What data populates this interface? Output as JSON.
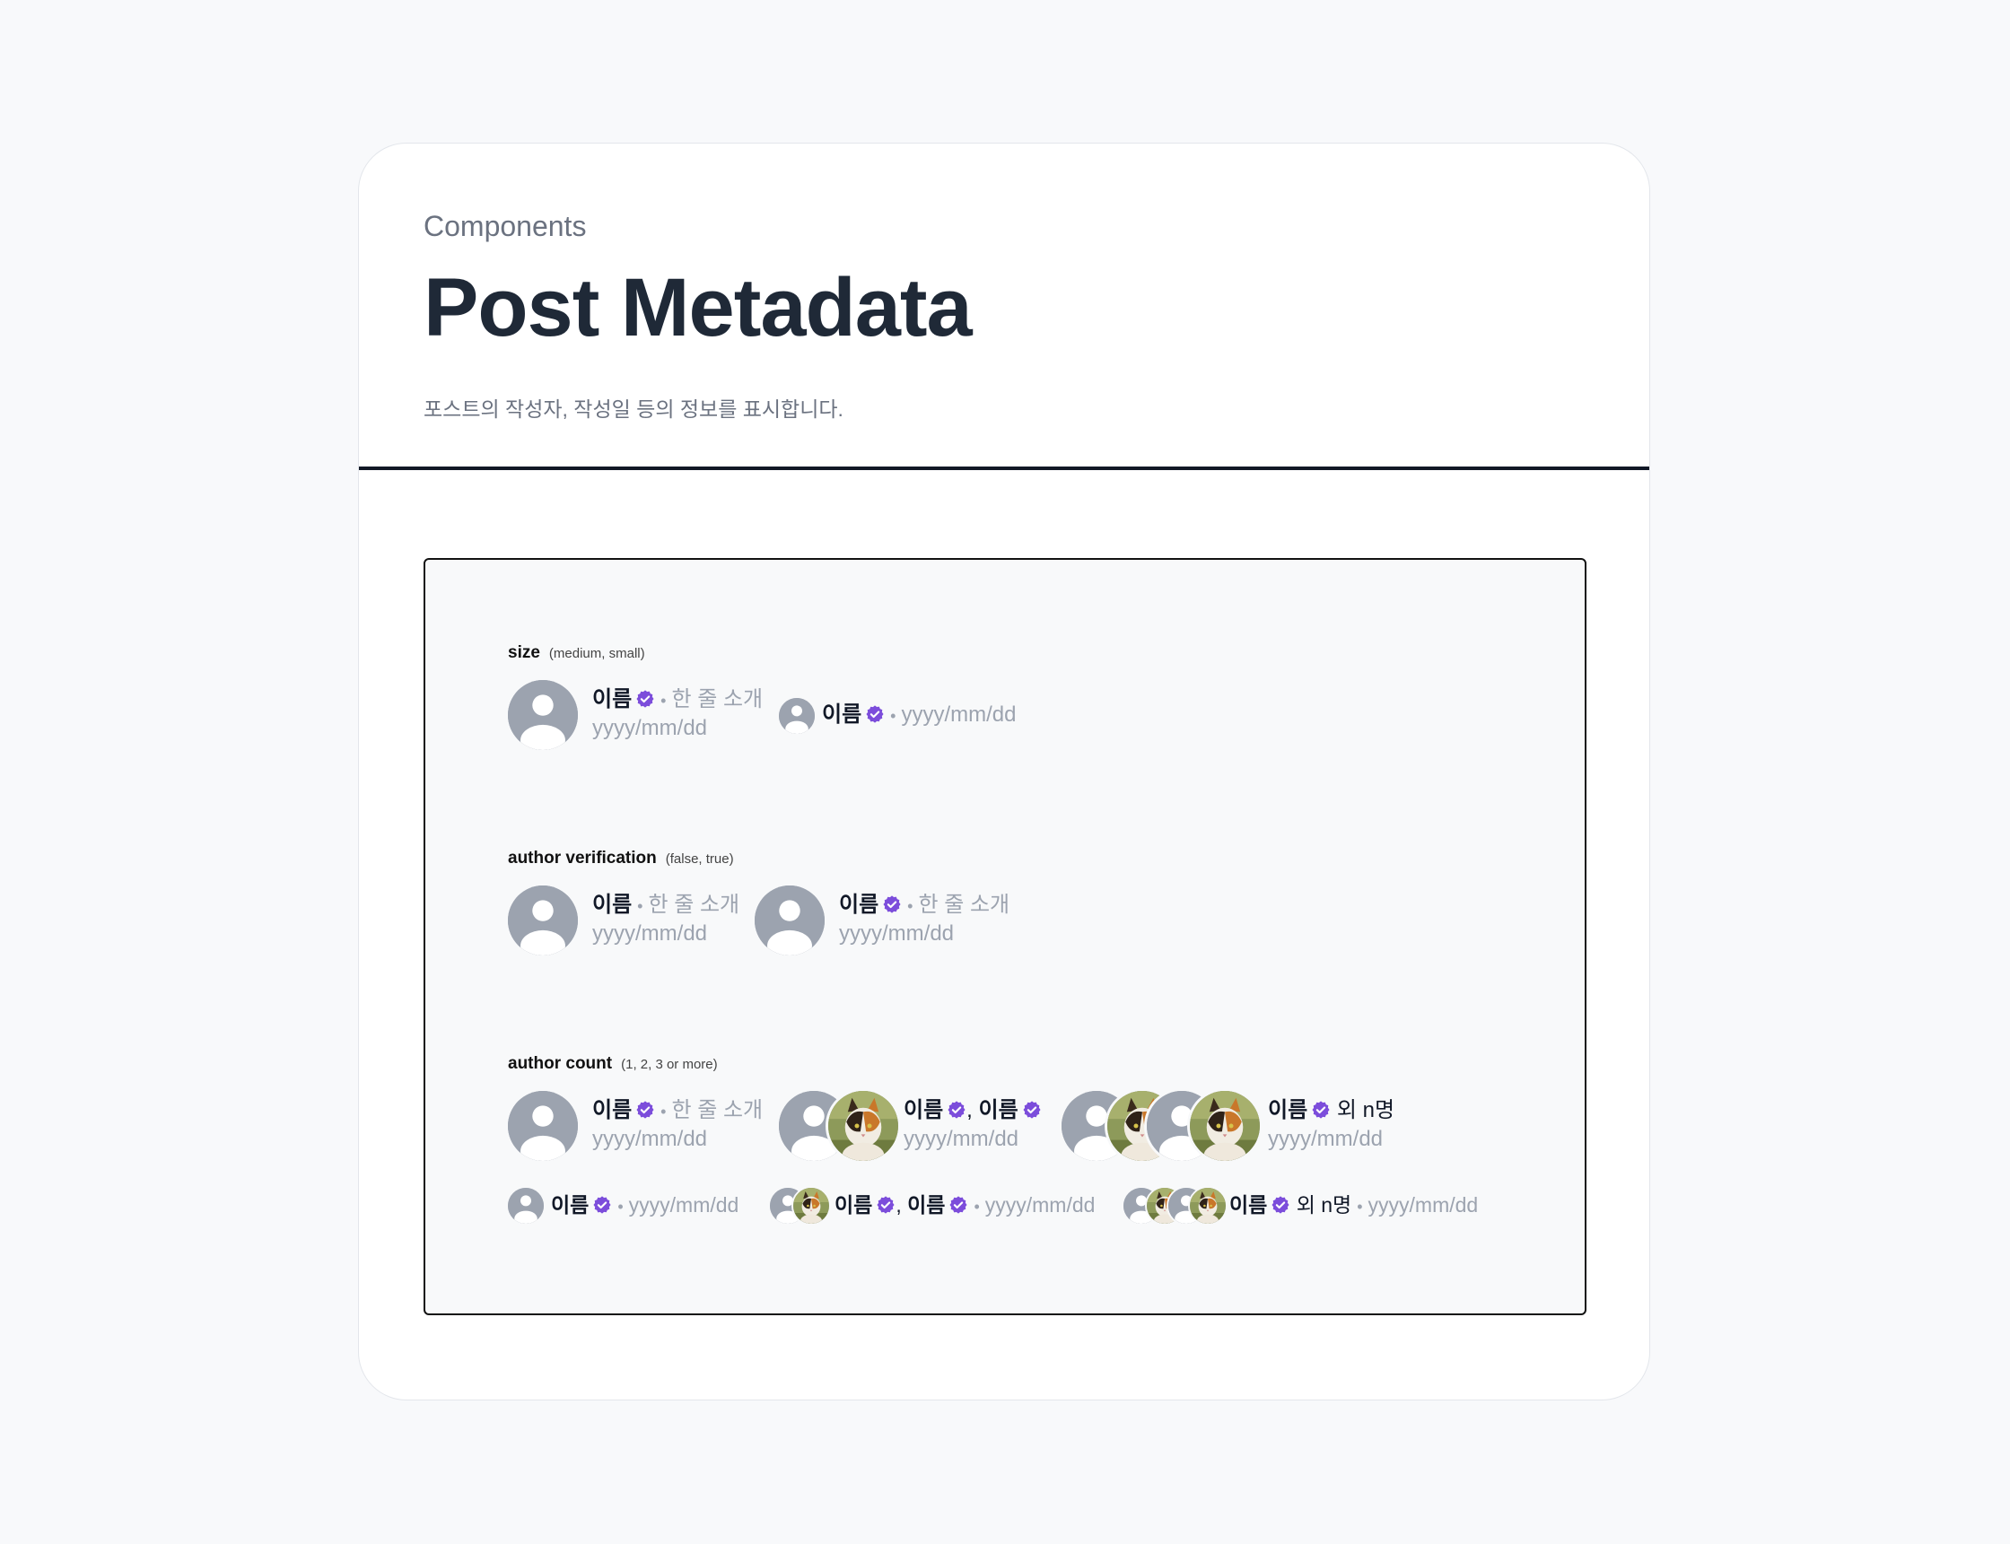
{
  "header": {
    "eyebrow": "Components",
    "title": "Post Metadata",
    "description": "포스트의 작성자, 작성일 등의 정보를 표시합니다."
  },
  "colors": {
    "badge": "#7c4ddb",
    "avatar": "#9ca3af",
    "accent_text": "#1f2937"
  },
  "sections": {
    "size": {
      "label": "size",
      "hint": "(medium, small)"
    },
    "verification": {
      "label": "author verification",
      "hint": "(false, true)"
    },
    "count": {
      "label": "author count",
      "hint": "(1, 2, 3 or more)"
    }
  },
  "text": {
    "name": "이름",
    "bio": "한 줄 소개",
    "date": "yyyy/mm/dd",
    "others": "외 n명",
    "bullet": "•",
    "comma": ","
  },
  "icons": {
    "avatar_placeholder": "person-icon",
    "verified": "verified-badge-icon",
    "photo": "cat-photo"
  }
}
